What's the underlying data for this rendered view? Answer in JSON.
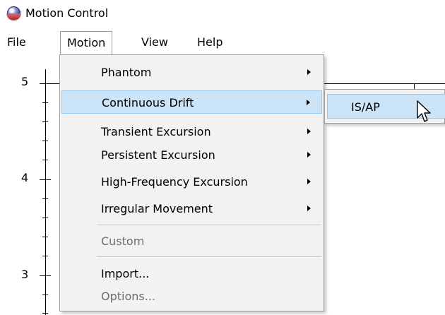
{
  "window": {
    "title": "Motion Control",
    "icon": "app-orb-icon"
  },
  "menubar": {
    "items": [
      "File",
      "Motion",
      "View",
      "Help"
    ],
    "open": "Motion"
  },
  "plot": {
    "y_tick_labels": [
      "5",
      "4",
      "3"
    ]
  },
  "motion_menu": {
    "items": [
      {
        "label": "Phantom",
        "submenu": true,
        "enabled": true
      },
      {
        "label": "Continuous Drift",
        "submenu": true,
        "enabled": true,
        "highlighted": true
      },
      {
        "label": "Transient Excursion",
        "submenu": true,
        "enabled": true
      },
      {
        "label": "Persistent Excursion",
        "submenu": true,
        "enabled": true
      },
      {
        "label": "High-Frequency Excursion",
        "submenu": true,
        "enabled": true
      },
      {
        "label": "Irregular Movement",
        "submenu": true,
        "enabled": true
      },
      {
        "label": "Custom",
        "submenu": false,
        "enabled": false
      },
      {
        "label": "Import...",
        "submenu": false,
        "enabled": true
      },
      {
        "label": "Options...",
        "submenu": false,
        "enabled": false
      }
    ]
  },
  "submenu": {
    "items": [
      {
        "label": "IS/AP",
        "highlighted": true
      }
    ]
  },
  "colors": {
    "highlight": "#cce4f7",
    "highlight_border": "#99c9ef",
    "menu_bg": "#f2f2f2",
    "disabled_text": "#6d6d6d"
  }
}
